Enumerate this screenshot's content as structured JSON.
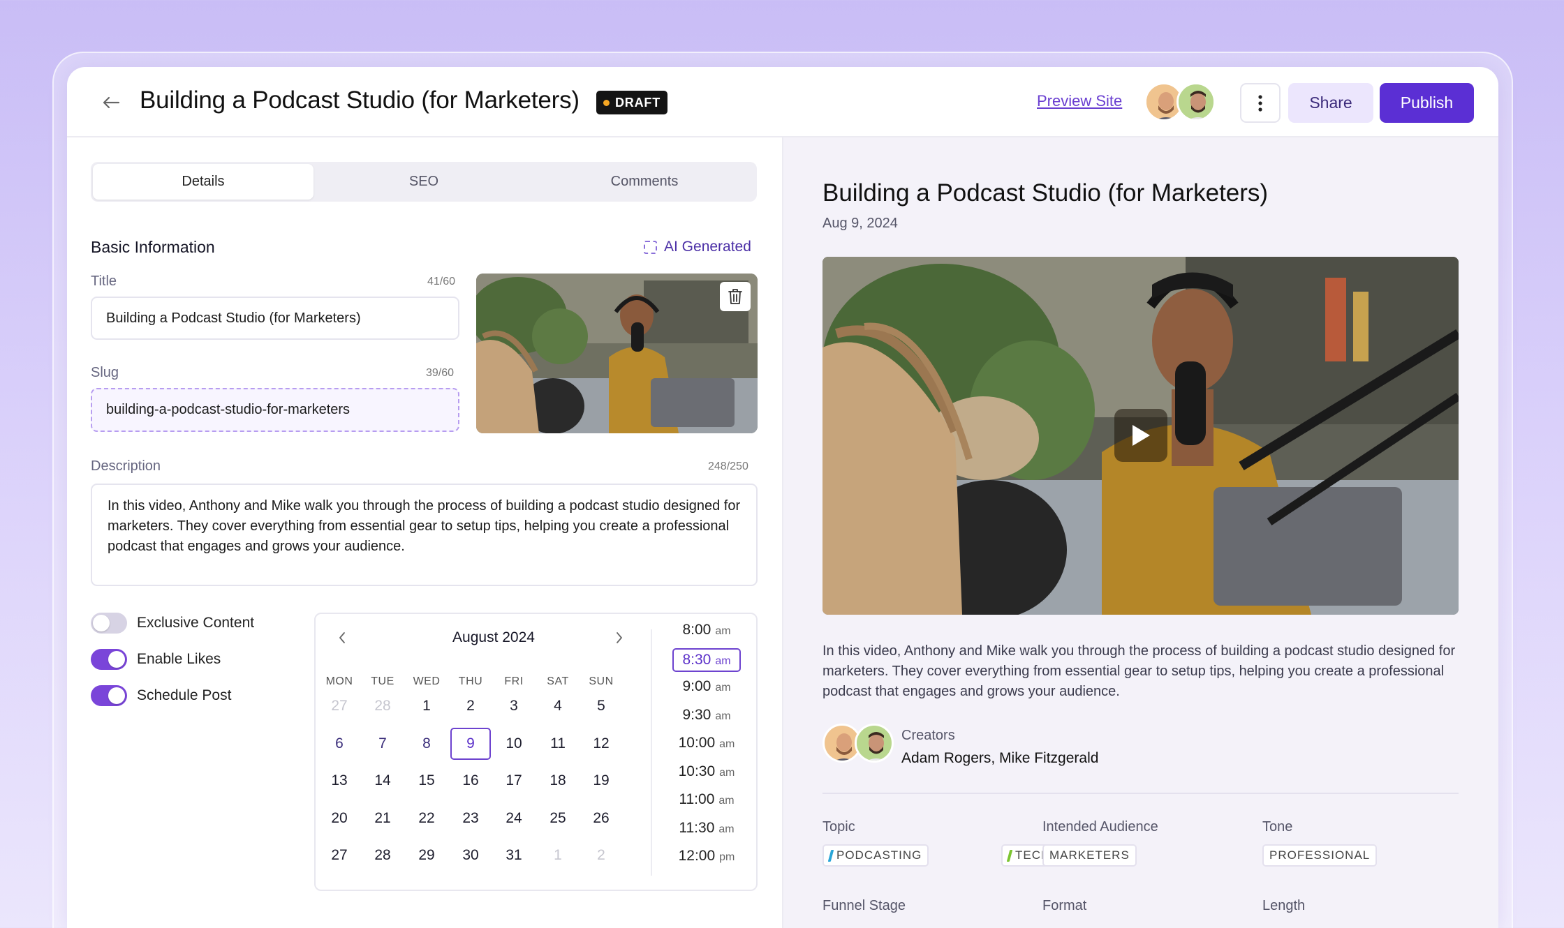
{
  "header": {
    "back_icon": "arrow-left-icon",
    "title": "Building a Podcast Studio (for Marketers)",
    "status_badge": "DRAFT",
    "status_color": "#f5a623",
    "preview_link": "Preview Site",
    "more_icon": "more-vertical-icon",
    "share_label": "Share",
    "publish_label": "Publish",
    "accent": "#5b2fd4"
  },
  "tabs": [
    {
      "label": "Details",
      "active": true
    },
    {
      "label": "SEO",
      "active": false
    },
    {
      "label": "Comments",
      "active": false
    }
  ],
  "basic": {
    "section_title": "Basic Information",
    "ai_label": "AI Generated",
    "title_label": "Title",
    "title_count": "41/60",
    "title_value": "Building a Podcast Studio (for Marketers)",
    "slug_label": "Slug",
    "slug_count": "39/60",
    "slug_value": "building-a-podcast-studio-for-marketers",
    "desc_label": "Description",
    "desc_count": "248/250",
    "desc_value": "In this video, Anthony and Mike walk you through the process of building a podcast studio designed for marketers. They cover everything from essential gear to setup tips, helping you create a professional podcast that engages and grows your audience."
  },
  "toggles": [
    {
      "label": "Exclusive Content",
      "on": false
    },
    {
      "label": "Enable Likes",
      "on": true
    },
    {
      "label": "Schedule Post",
      "on": true
    }
  ],
  "calendar": {
    "month": "August 2024",
    "weekdays": [
      "MON",
      "TUE",
      "WED",
      "THU",
      "FRI",
      "SAT",
      "SUN"
    ],
    "weeks": [
      [
        "27",
        "28",
        "1",
        "2",
        "3",
        "4",
        "5"
      ],
      [
        "6",
        "7",
        "8",
        "9",
        "10",
        "11",
        "12"
      ],
      [
        "13",
        "14",
        "15",
        "16",
        "17",
        "18",
        "19"
      ],
      [
        "20",
        "21",
        "22",
        "23",
        "24",
        "25",
        "26"
      ],
      [
        "27",
        "28",
        "29",
        "30",
        "31",
        "1",
        "2"
      ]
    ],
    "selected": "9",
    "times": [
      {
        "t": "8:00",
        "ap": "am"
      },
      {
        "t": "8:30",
        "ap": "am",
        "selected": true
      },
      {
        "t": "9:00",
        "ap": "am"
      },
      {
        "t": "9:30",
        "ap": "am"
      },
      {
        "t": "10:00",
        "ap": "am"
      },
      {
        "t": "10:30",
        "ap": "am"
      },
      {
        "t": "11:00",
        "ap": "am"
      },
      {
        "t": "11:30",
        "ap": "am"
      },
      {
        "t": "12:00",
        "ap": "pm"
      }
    ]
  },
  "preview": {
    "title": "Building a Podcast Studio (for Marketers)",
    "date": "Aug 9, 2024",
    "description": "In this video, Anthony and Mike walk you through the process of building a podcast studio designed for marketers. They cover everything from essential gear to setup tips, helping you create a professional podcast that engages and grows your audience.",
    "creators_label": "Creators",
    "creators": "Adam Rogers, Mike Fitzgerald",
    "topic_label": "Topic",
    "topic_tags": [
      {
        "label": "PODCASTING",
        "color": "#2aa6d8"
      },
      {
        "label": "TECH",
        "color": "#7cc531"
      }
    ],
    "audience_label": "Intended Audience",
    "audience_tag": "MARKETERS",
    "tone_label": "Tone",
    "tone_tag": "PROFESSIONAL",
    "funnel_label": "Funnel Stage",
    "format_label": "Format",
    "length_label": "Length"
  }
}
